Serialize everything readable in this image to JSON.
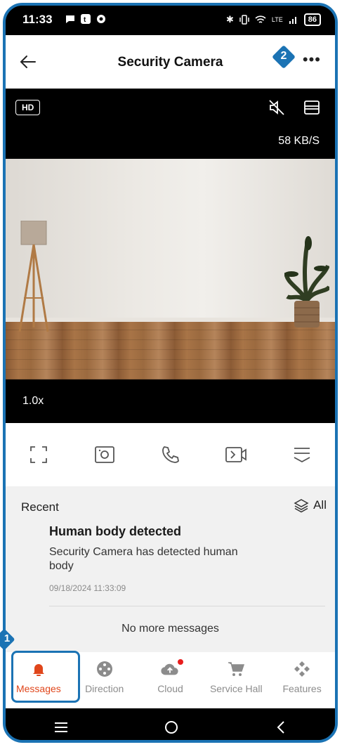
{
  "status_bar": {
    "time": "11:33",
    "battery": "86",
    "network": "LTE"
  },
  "header": {
    "title": "Security Camera",
    "badge": "2"
  },
  "video": {
    "quality": "HD",
    "bitrate": "58 KB/S",
    "zoom": "1.0x"
  },
  "recent": {
    "label": "Recent",
    "filter": "All",
    "message": {
      "title": "Human body detected",
      "body": "Security Camera has detected human body",
      "timestamp": "09/18/2024 11:33:09"
    },
    "end_text": "No more messages"
  },
  "tabs": [
    {
      "label": "Messages",
      "icon": "bell-icon",
      "active": true
    },
    {
      "label": "Direction",
      "icon": "joystick-icon"
    },
    {
      "label": "Cloud",
      "icon": "cloud-upload-icon"
    },
    {
      "label": "Service Hall",
      "icon": "cart-icon"
    },
    {
      "label": "Features",
      "icon": "diamond-grid-icon"
    }
  ],
  "callout_badge": "1",
  "colors": {
    "accent": "#e0461b",
    "highlight": "#1b73b4"
  }
}
